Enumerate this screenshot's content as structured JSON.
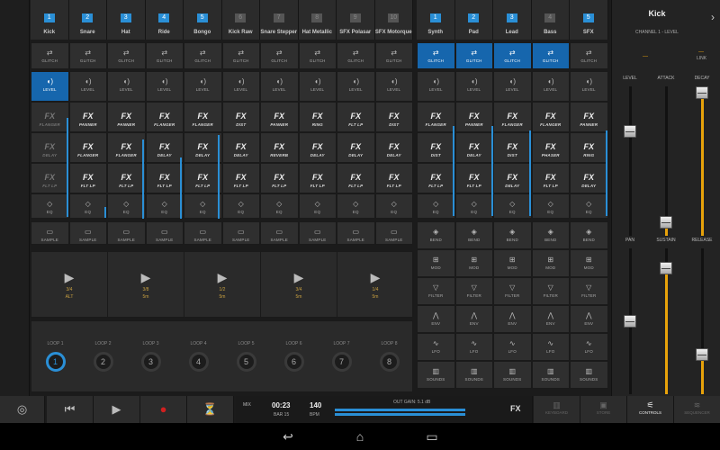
{
  "channels_left": [
    {
      "num": "1",
      "name": "Kick",
      "on": true
    },
    {
      "num": "2",
      "name": "Snare",
      "on": true
    },
    {
      "num": "3",
      "name": "Hat",
      "on": true
    },
    {
      "num": "4",
      "name": "Ride",
      "on": true
    },
    {
      "num": "5",
      "name": "Bongo",
      "on": true
    },
    {
      "num": "6",
      "name": "Kick Raw",
      "on": false
    },
    {
      "num": "7",
      "name": "Snare Stepper",
      "on": false
    },
    {
      "num": "8",
      "name": "Hat Metallic",
      "on": false
    },
    {
      "num": "9",
      "name": "SFX Polasar",
      "on": false
    },
    {
      "num": "10",
      "name": "SFX Motorque",
      "on": false
    }
  ],
  "channels_right": [
    {
      "num": "1",
      "name": "Synth",
      "on": true
    },
    {
      "num": "2",
      "name": "Pad",
      "on": true
    },
    {
      "num": "3",
      "name": "Lead",
      "on": true
    },
    {
      "num": "4",
      "name": "Bass",
      "on": false
    },
    {
      "num": "5",
      "name": "SFX",
      "on": true
    }
  ],
  "labels": {
    "glitch": "GLITCH",
    "level": "LEVEL",
    "fx": "FX",
    "eq": "EQ",
    "sample": "SAMPLE",
    "bend": "BEND",
    "mod": "MOD",
    "filter": "FILTER",
    "env": "ENV",
    "lfo": "LFO",
    "sounds": "SOUNDS"
  },
  "fx_left": [
    [
      "FLANGER",
      "DELAY",
      "FLT LP"
    ],
    [
      "PANNER",
      "FLANGER",
      "FLT LP"
    ],
    [
      "PANNER",
      "FLANGER",
      "FLT LP"
    ],
    [
      "FLANGER",
      "DELAY",
      "FLT LP"
    ],
    [
      "FLANGER",
      "DELAY",
      "FLT LP"
    ],
    [
      "DIST",
      "DELAY",
      "FLT LP"
    ],
    [
      "PANNER",
      "REVERB",
      "FLT LP"
    ],
    [
      "RING",
      "DELAY",
      "FLT LP"
    ],
    [
      "FLT LP",
      "DELAY",
      "FLT LP"
    ],
    [
      "DIST",
      "DELAY",
      "FLT LP"
    ]
  ],
  "fx_right": [
    [
      "FLANGER",
      "DIST",
      "FLT LP"
    ],
    [
      "PANNER",
      "DELAY",
      "FLT LP"
    ],
    [
      "FLANGER",
      "DIST",
      "DELAY"
    ],
    [
      "FLANGER",
      "PHASER",
      "FLT LP"
    ],
    [
      "PANNER",
      "RING",
      "DELAY"
    ]
  ],
  "steps": [
    {
      "t": "3/4",
      "s": "ALT"
    },
    {
      "t": "3/8",
      "s": "5m"
    },
    {
      "t": "1/2",
      "s": "5m"
    },
    {
      "t": "3/4",
      "s": "5m"
    },
    {
      "t": "1/4",
      "s": "5m"
    }
  ],
  "loops": [
    {
      "label": "LOOP 1",
      "n": "1"
    },
    {
      "label": "LOOP 2",
      "n": "2"
    },
    {
      "label": "LOOP 3",
      "n": "3"
    },
    {
      "label": "LOOP 4",
      "n": "4"
    },
    {
      "label": "LOOP 5",
      "n": "5"
    },
    {
      "label": "LOOP 6",
      "n": "6"
    },
    {
      "label": "LOOP 7",
      "n": "7"
    },
    {
      "label": "LOOP 8",
      "n": "8"
    }
  ],
  "right_panel": {
    "title": "Kick",
    "subtitle": "CHANNEL 1 - LEVEL",
    "dash": "—",
    "link": "LINK",
    "params": [
      {
        "label": "LEVEL",
        "value": 0.72
      },
      {
        "label": "ATTACK",
        "value": 0.05
      },
      {
        "label": "DECAY",
        "value": 1.0
      },
      {
        "label": "PAN",
        "value": 0.5
      },
      {
        "label": "SUSTAIN",
        "value": 0.9
      },
      {
        "label": "RELEASE",
        "value": 0.25
      }
    ]
  },
  "transport": {
    "time": "00:23",
    "bar": "BAR 15",
    "bpm": "140",
    "bpm_label": "BPM",
    "mix_label": "MIX",
    "out_gain": "OUT GAIN: 5.1 dB",
    "fx": "FX"
  },
  "modes": [
    "KEYBOARD",
    "STORE",
    "CONTROLS",
    "SEQUENCER"
  ],
  "nav": {
    "back": "↩",
    "home": "⌂",
    "recent": "▭"
  }
}
